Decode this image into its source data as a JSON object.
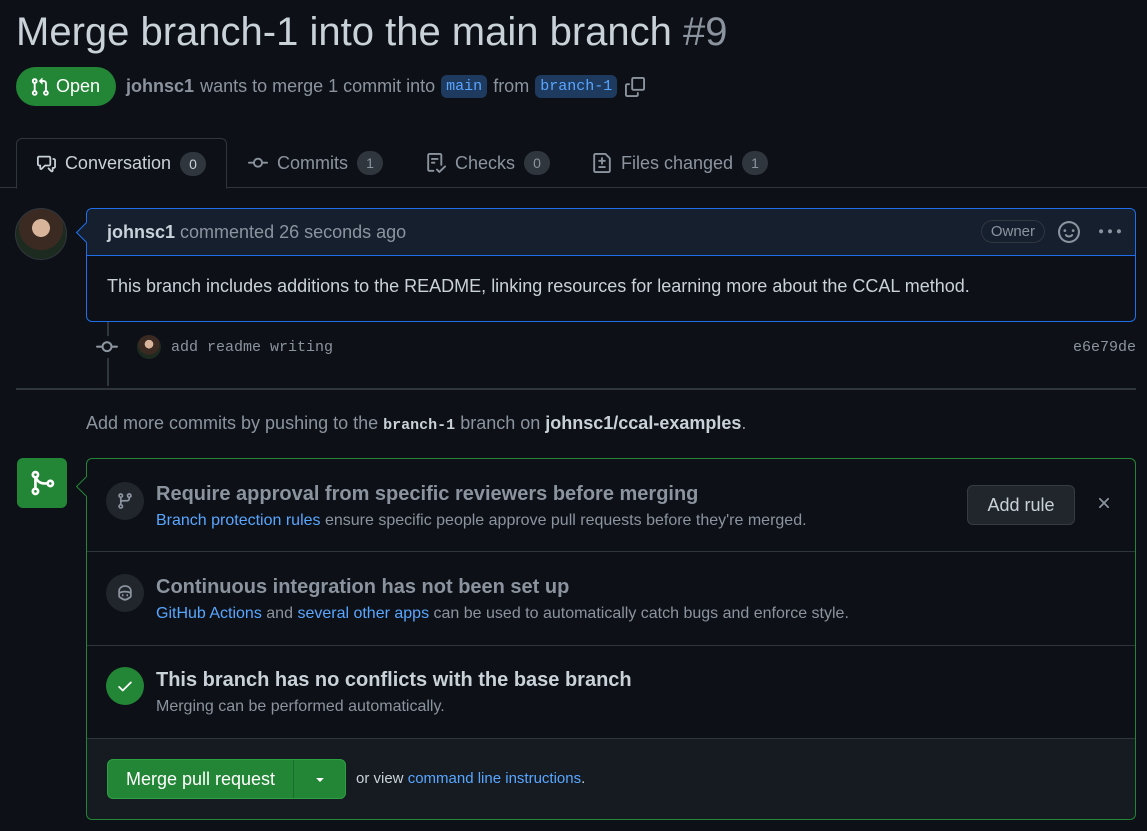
{
  "header": {
    "title": "Merge branch-1 into the main branch",
    "number": "#9",
    "state": "Open",
    "author": "johnsc1",
    "merge_text_1": "wants to merge 1 commit into",
    "base_branch": "main",
    "from_text": "from",
    "head_branch": "branch-1"
  },
  "tabs": [
    {
      "label": "Conversation",
      "count": "0",
      "icon": "comment-discussion-icon"
    },
    {
      "label": "Commits",
      "count": "1",
      "icon": "git-commit-icon"
    },
    {
      "label": "Checks",
      "count": "0",
      "icon": "checklist-icon"
    },
    {
      "label": "Files changed",
      "count": "1",
      "icon": "file-diff-icon"
    }
  ],
  "comment": {
    "author": "johnsc1",
    "action": "commented 26 seconds ago",
    "badge": "Owner",
    "body": "This branch includes additions to the README, linking resources for learning more about the CCAL method."
  },
  "commit": {
    "message": "add readme writing",
    "sha": "e6e79de"
  },
  "push_hint": {
    "prefix": "Add more commits by pushing to the",
    "branch": "branch-1",
    "middle": "branch on",
    "repo": "johnsc1/ccal-examples",
    "suffix": "."
  },
  "merge_box": {
    "approval": {
      "title": "Require approval from specific reviewers before merging",
      "link": "Branch protection rules",
      "text": "ensure specific people approve pull requests before they're merged.",
      "button": "Add rule"
    },
    "ci": {
      "title": "Continuous integration has not been set up",
      "link1": "GitHub Actions",
      "and": "and",
      "link2": "several other apps",
      "text": "can be used to automatically catch bugs and enforce style."
    },
    "conflicts": {
      "title": "This branch has no conflicts with the base branch",
      "text": "Merging can be performed automatically."
    },
    "merge": {
      "button": "Merge pull request",
      "or_view": "or view",
      "link": "command line instructions",
      "suffix": "."
    }
  },
  "colors": {
    "background": "#0d1117",
    "accent_green": "#238636",
    "link_blue": "#58a6ff",
    "border": "#30363d"
  }
}
